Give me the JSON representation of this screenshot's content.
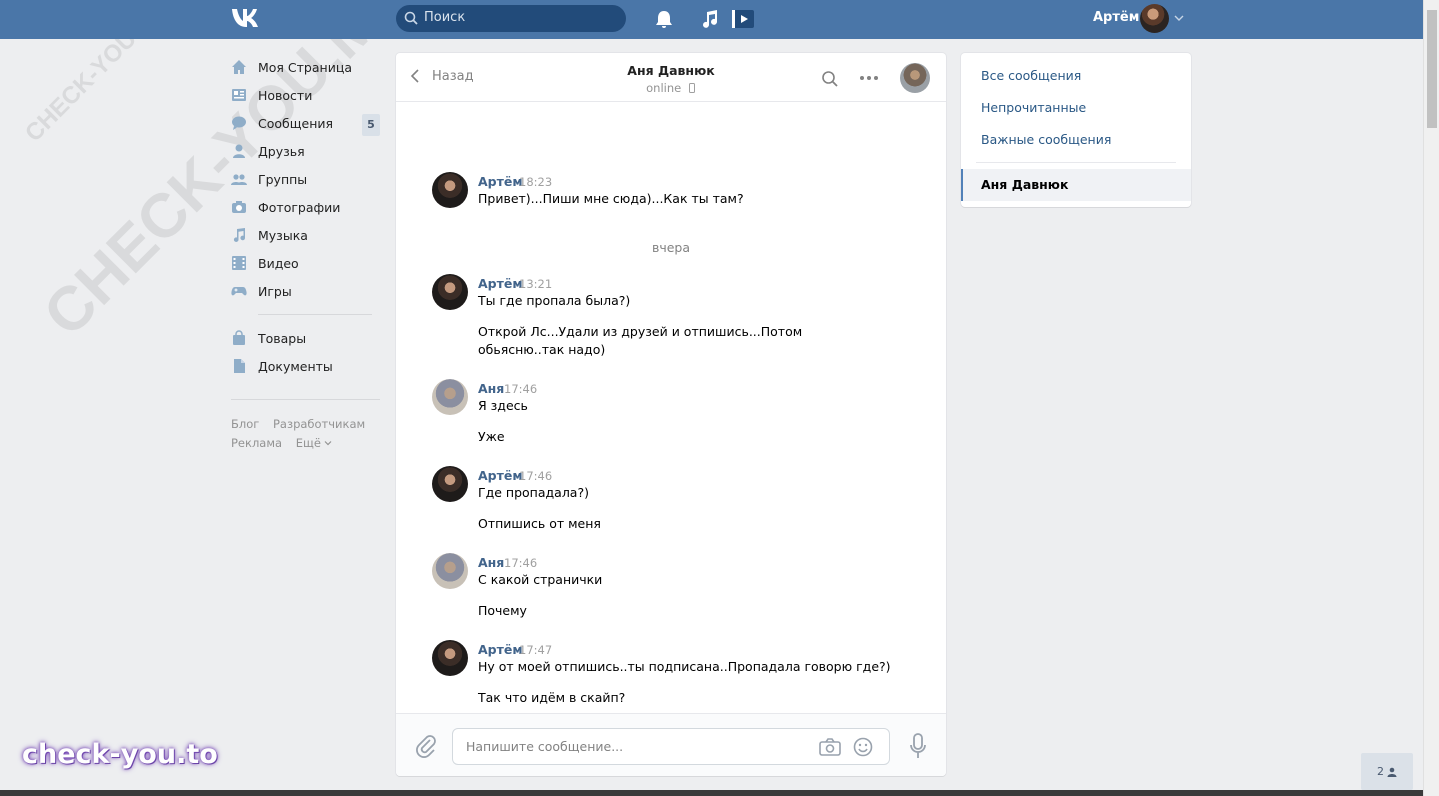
{
  "header": {
    "search_placeholder": "Поиск",
    "user_name": "Артём"
  },
  "nav": {
    "items": [
      {
        "label": "Моя Страница",
        "icon": "home-icon"
      },
      {
        "label": "Новости",
        "icon": "news-icon"
      },
      {
        "label": "Сообщения",
        "icon": "messages-icon",
        "badge": "5"
      },
      {
        "label": "Друзья",
        "icon": "friends-icon"
      },
      {
        "label": "Группы",
        "icon": "groups-icon"
      },
      {
        "label": "Фотографии",
        "icon": "camera-icon"
      },
      {
        "label": "Музыка",
        "icon": "music-icon"
      },
      {
        "label": "Видео",
        "icon": "video-icon"
      },
      {
        "label": "Игры",
        "icon": "gamepad-icon"
      },
      {
        "label": "Товары",
        "icon": "bag-icon"
      },
      {
        "label": "Документы",
        "icon": "document-icon"
      }
    ],
    "footer": [
      "Блог",
      "Разработчикам",
      "Реклама",
      "Ещё"
    ]
  },
  "chat": {
    "back_label": "Назад",
    "peer_name": "Аня Давнюк",
    "peer_status": "online",
    "day_separator": "вчера",
    "messages": [
      {
        "author": "Артём",
        "time": "18:23",
        "texts": [
          "Привет)...Пиши мне сюда)...Как ты там?"
        ]
      },
      {
        "author": "Артём",
        "time": "13:21",
        "texts": [
          "Ты где пропала была?)",
          "Открой Лс...Удали из друзей и отпишись...Потом обьясню..так надо)"
        ]
      },
      {
        "author": "Аня",
        "time": "17:46",
        "texts": [
          "Я здесь",
          "Уже"
        ]
      },
      {
        "author": "Артём",
        "time": "17:46",
        "texts": [
          "Где пропадала?)",
          "Отпишись от меня"
        ]
      },
      {
        "author": "Аня",
        "time": "17:46",
        "texts": [
          "С какой странички",
          "Почему"
        ]
      },
      {
        "author": "Артём",
        "time": "17:47",
        "texts": [
          "Ну от моей отпишись..ты подписана..Пропадала говорю где?)",
          "Так что идём в скайп?"
        ]
      }
    ],
    "composer_placeholder": "Напишите сообщение..."
  },
  "filters": {
    "items": [
      "Все сообщения",
      "Непрочитанные",
      "Важные сообщения"
    ],
    "active_conversation": "Аня Давнюк"
  },
  "online_chip": "2",
  "watermarks": {
    "big": "CHECK-YOU.ME",
    "promo": "check-you.to"
  },
  "colors": {
    "header": "#4a76a8",
    "link": "#2a5885",
    "author": "#42648b"
  }
}
